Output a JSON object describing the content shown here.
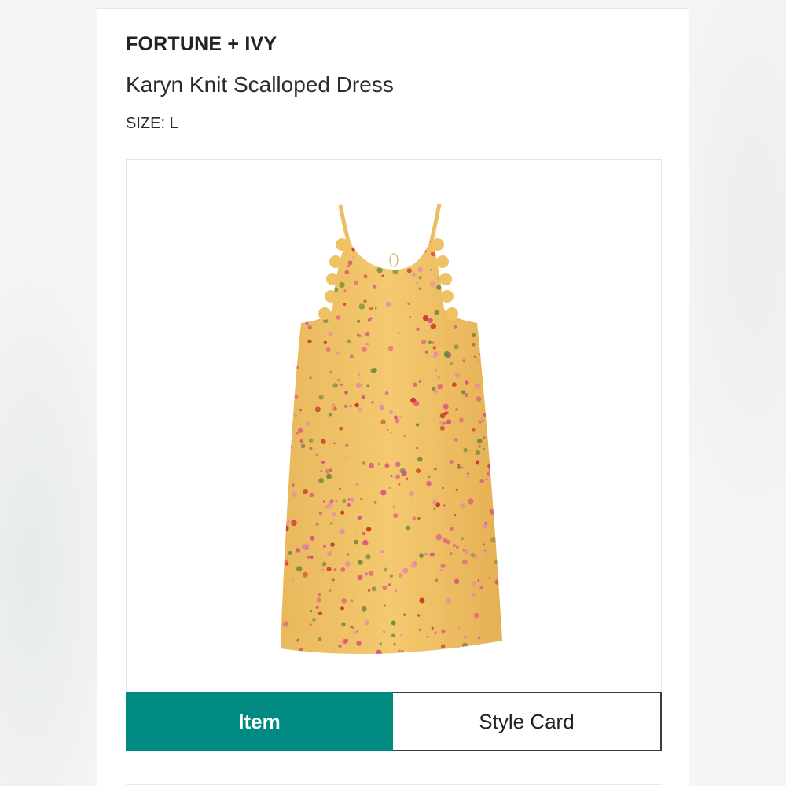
{
  "product": {
    "brand": "FORTUNE + IVY",
    "name": "Karyn Knit Scalloped Dress",
    "size_label": "SIZE: L"
  },
  "image": {
    "icon": "floral-dress-image",
    "colors": {
      "fabric": "#f2c46a",
      "fabric_shadow": "#e6ae4f",
      "flower_pink": "#d94f86",
      "flower_red": "#c8342a",
      "leaf_green": "#6f8a3a"
    }
  },
  "tabs": [
    {
      "label": "Item",
      "active": true
    },
    {
      "label": "Style Card",
      "active": false
    }
  ],
  "colors": {
    "accent": "#008a82"
  }
}
